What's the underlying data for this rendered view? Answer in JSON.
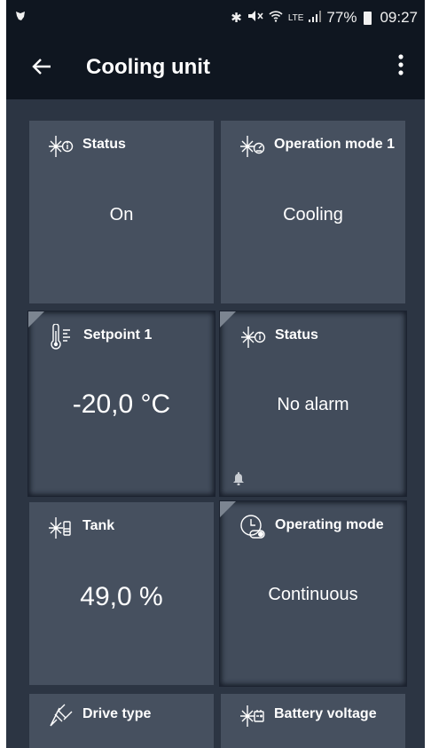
{
  "statusbar": {
    "battery": "77%",
    "time": "09:27",
    "network": "LTE"
  },
  "appbar": {
    "title": "Cooling unit",
    "back_icon": "arrow-left-icon",
    "menu_icon": "more-vert-icon"
  },
  "tiles": [
    {
      "label": "Status",
      "value": "On",
      "icon": "snowflake-info-icon"
    },
    {
      "label": "Operation mode 1",
      "value": "Cooling",
      "icon": "snowflake-gauge-icon"
    },
    {
      "label": "Setpoint 1",
      "value": "-20,0 °C",
      "icon": "thermometer-icon"
    },
    {
      "label": "Status",
      "value": "No alarm",
      "icon": "snowflake-info-icon"
    },
    {
      "label": "Tank",
      "value": "49,0 %",
      "icon": "snowflake-tank-icon"
    },
    {
      "label": "Operating mode",
      "value": "Continuous",
      "icon": "clock-toggle-icon"
    },
    {
      "label": "Drive type",
      "value": "",
      "icon": "plug-icon"
    },
    {
      "label": "Battery voltage",
      "value": "",
      "icon": "snowflake-battery-icon"
    }
  ],
  "colors": {
    "bars": "#0f1620",
    "background": "#2c3543",
    "tile": "#46505f"
  }
}
